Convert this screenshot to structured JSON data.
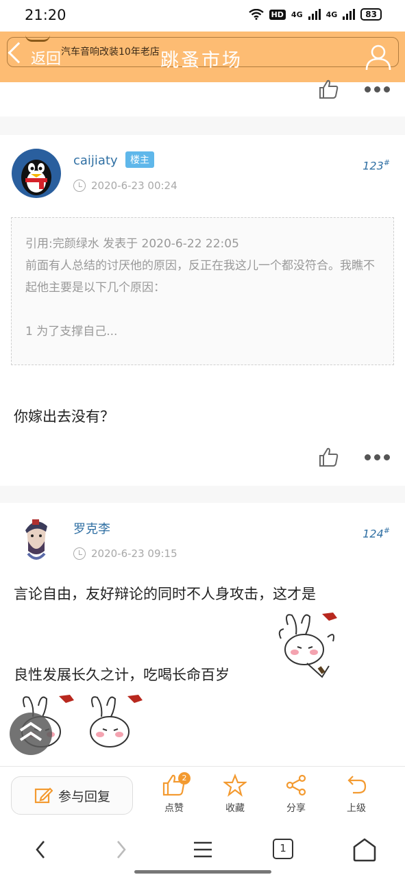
{
  "status": {
    "time": "21:20",
    "hd": "HD",
    "net1": "4G",
    "net2": "4G",
    "battery": "83"
  },
  "header": {
    "banner_text": "汽车音响改装10年老店",
    "back_label": "返回",
    "title": "跳蚤市场"
  },
  "posts": [
    {
      "author": "caijiaty",
      "badge": "楼主",
      "date": "2020-6-23 00:24",
      "floor": "123",
      "quote_head": "引用:完颜绿水 发表于 2020-6-22 22:05",
      "quote_body": "前面有人总结的讨厌他的原因，反正在我这儿一个都没符合。我瞧不起他主要是以下几个原因：",
      "quote_tail": "1 为了支撑自己...",
      "content": "你嫁出去没有？"
    },
    {
      "author": "罗克李",
      "date": "2020-6-23 09:15",
      "floor": "124",
      "line1": "言论自由，友好辩论的同时不人身攻击，这才是",
      "line2": "良性发展长久之计，吃喝长命百岁"
    }
  ],
  "toolbar": {
    "reply_label": "参与回复",
    "like_label": "点赞",
    "like_count": "2",
    "favorite_label": "收藏",
    "share_label": "分享",
    "up_label": "上级"
  },
  "browser_nav": {
    "tab_count": "1"
  },
  "colors": {
    "accent": "#fdbc73",
    "link": "#2f6fa3",
    "icon_orange": "#f39a30"
  }
}
